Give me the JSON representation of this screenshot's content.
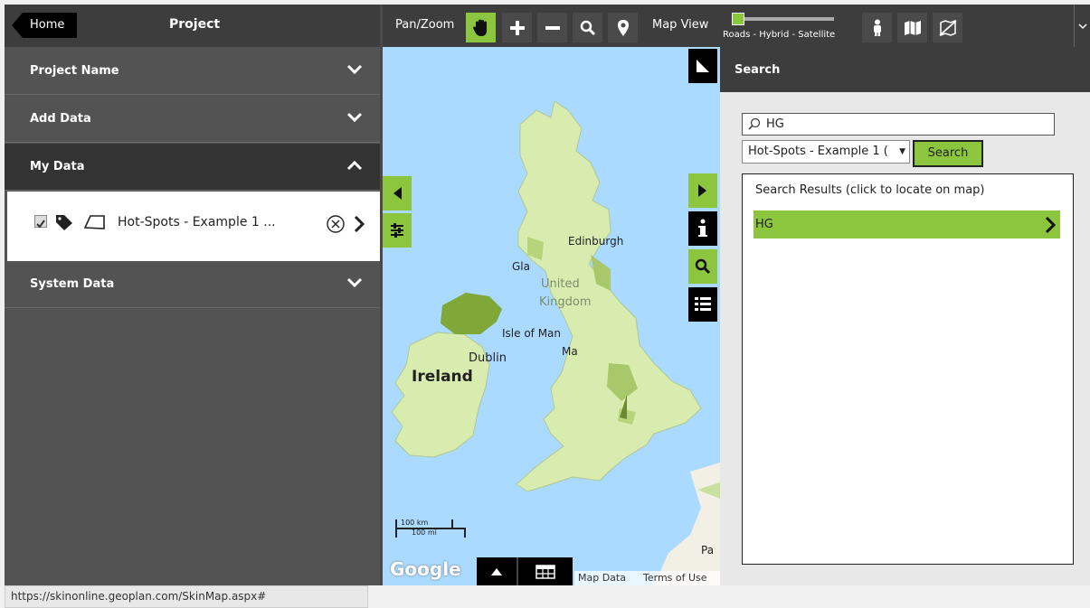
{
  "left": {
    "home_label": "Home",
    "project_title": "Project",
    "sections": {
      "project_name": "Project Name",
      "add_data": "Add Data",
      "my_data": "My Data",
      "system_data": "System Data"
    },
    "my_data_item": "Hot-Spots - Example 1 ..."
  },
  "toolbar": {
    "pan_zoom_label": "Pan/Zoom",
    "map_view_label": "Map View",
    "map_view_options": "Roads - Hybrid - Satellite"
  },
  "map": {
    "labels": {
      "ireland": "Ireland",
      "dublin": "Dublin",
      "united": "United",
      "kingdom": "Kingdom",
      "isle_of_man": "Isle of Man",
      "edinburgh": "Edinburgh",
      "glasgow": "Gla",
      "manchester": "Ma",
      "paris": "Pa"
    },
    "scale_km": "100 km",
    "scale_mi": "100 mi",
    "google_logo": "Google",
    "map_data": "Map Data",
    "terms": "Terms of Use"
  },
  "search": {
    "title": "Search",
    "query": "HG",
    "layer": "Hot-Spots - Example 1 (",
    "button": "Search",
    "results_header": "Search Results (click to locate on map)",
    "results": [
      "HG"
    ]
  },
  "status_url": "https://skinonline.geoplan.com/SkinMap.aspx#",
  "colors": {
    "accent": "#8cc63f",
    "panel_dark": "#3d3d3d",
    "panel": "#535353",
    "water": "#aadaff",
    "land": "#d9ecb0"
  }
}
